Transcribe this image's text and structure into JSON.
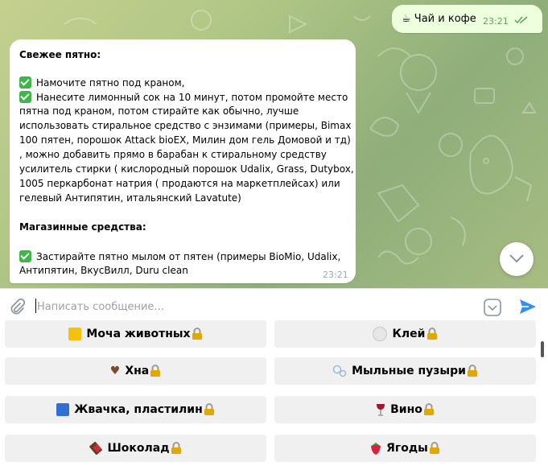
{
  "outgoing": {
    "emoji": "☕",
    "text": "Чай и кофе",
    "time": "23:21"
  },
  "incoming": {
    "lines": [
      "Свежее пятно:",
      "Намочите пятно под краном,",
      "Нанесите лимонный сок на 10 минут, потом промойте место",
      "пятна под краном, потом стирайте как обычно, лучше",
      "использовать стиральное средство с энзимами (примеры, Bimax",
      "100 пятен, порошок Attack bioEX, Милин дом гель Домовой и тд)",
      ", можно добавить прямо в барабан к стиральному средству",
      "усилитель стирки ( кислородный порошок Udalix, Grass, Dutybox,",
      "1005 перкарбонат натрия ( продаются на маркетплейсах) или",
      "гелевый Антипятин, итальянский Lavatute)",
      "Магазинные средства:",
      "Застирайте пятно мылом от пятен (примеры BioMio,  Udalix,",
      "Антипятин, ВкусВилл, Duru clean"
    ],
    "time": "23:21"
  },
  "composer": {
    "placeholder": "Написать сообщение..."
  },
  "keyboard": {
    "buttons": [
      {
        "emoji": "🟨",
        "label": "Моча животных"
      },
      {
        "emoji": "⚪",
        "label": "Клей"
      },
      {
        "emoji": "🤎",
        "label": "Хна"
      },
      {
        "emoji": "🫧",
        "label": "Мыльные пузыри"
      },
      {
        "emoji": "🟦",
        "label": "Жвачка, пластилин"
      },
      {
        "emoji": "🍷",
        "label": "Вино"
      },
      {
        "emoji": "🍫",
        "label": "Шоколад"
      },
      {
        "emoji": "🍓",
        "label": "Ягоды"
      }
    ]
  },
  "colors": {
    "accent": "#3390ec",
    "outgoing_bubble": "#eeffde",
    "check": "#3fb54c"
  }
}
